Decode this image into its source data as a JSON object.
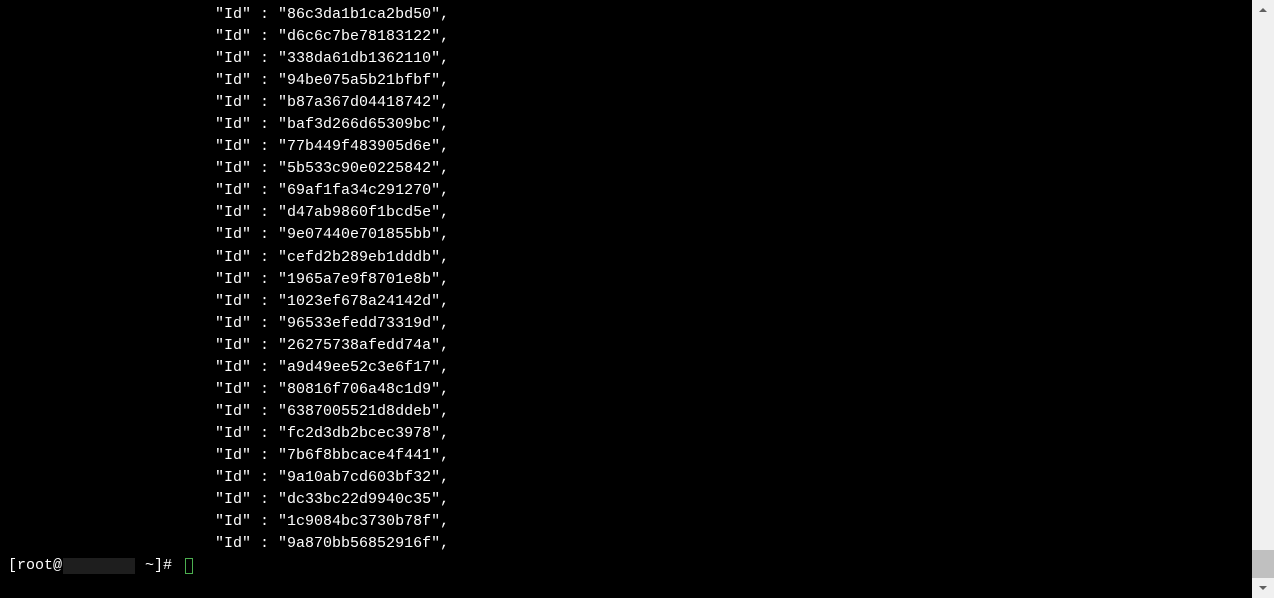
{
  "indent": "                       ",
  "key": "\"Id\"",
  "sep": " : ",
  "ids": [
    "86c3da1b1ca2bd50",
    "d6c6c7be78183122",
    "338da61db1362110",
    "94be075a5b21bfbf",
    "b87a367d04418742",
    "baf3d266d65309bc",
    "77b449f483905d6e",
    "5b533c90e0225842",
    "69af1fa34c291270",
    "d47ab9860f1bcd5e",
    "9e07440e701855bb",
    "cefd2b289eb1dddb",
    "1965a7e9f8701e8b",
    "1023ef678a24142d",
    "96533efedd73319d",
    "26275738afedd74a",
    "a9d49ee52c3e6f17",
    "80816f706a48c1d9",
    "6387005521d8ddeb",
    "fc2d3db2bcec3978",
    "7b6f8bbcace4f441",
    "9a10ab7cd603bf32",
    "dc33bc22d9940c35",
    "1c9084bc3730b78f",
    "9a870bb56852916f"
  ],
  "prompt": {
    "open_bracket": "[",
    "user": "root@",
    "suffix": " ~]# "
  }
}
